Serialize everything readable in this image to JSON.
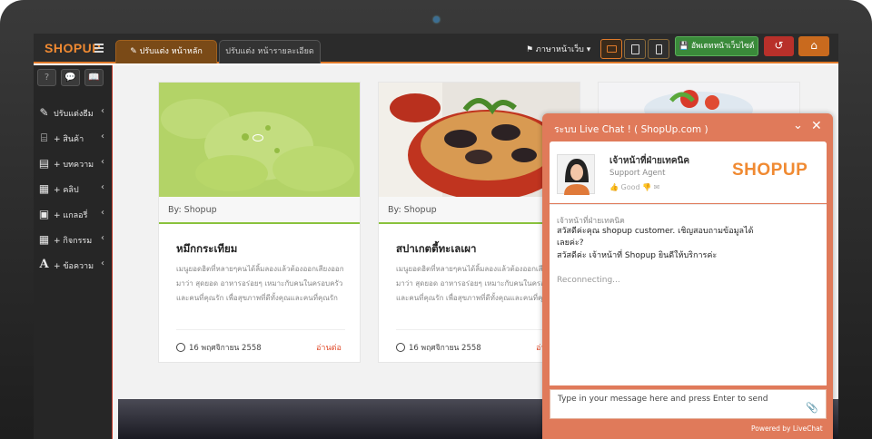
{
  "topbar": {
    "logo": "SHOPUP",
    "tabs": [
      {
        "label": "ปรับแต่ง หน้าหลัก",
        "active": true
      },
      {
        "label": "ปรับแต่ง หน้ารายละเอียด",
        "active": false
      }
    ],
    "language": "⚑ ภาษาหน้าเว็บ ▾",
    "update_label": "💾 อัพเดทหน้าเว็บไซต์",
    "undo_icon": "undo-icon",
    "home_icon": "home-icon",
    "accent_color": "#e07a2a"
  },
  "sidebar": {
    "tools": [
      "?",
      "💬",
      "📖"
    ],
    "items": [
      {
        "label": "ปรับแต่งธีม",
        "icon": "edit-icon",
        "glyph": "✎"
      },
      {
        "label": "+ สินค้า",
        "icon": "gift-icon",
        "glyph": "🎁"
      },
      {
        "label": "+ บทความ",
        "icon": "document-icon",
        "glyph": "▤"
      },
      {
        "label": "+ คลิป",
        "icon": "film-icon",
        "glyph": "▦"
      },
      {
        "label": "+ แกลอรี่",
        "icon": "image-icon",
        "glyph": "▣"
      },
      {
        "label": "+ กิจกรรม",
        "icon": "calendar-icon",
        "glyph": "▦"
      },
      {
        "label": "+ ข้อความ",
        "icon": "text-icon",
        "glyph": "A"
      }
    ]
  },
  "cards": [
    {
      "by": "By:  Shopup",
      "title": "หมึกกระเทียม",
      "desc": "เมนูยอดฮิตที่หลายๆคนได้ลิ้มลองแล้วต้องออกเสียงออกมาว่า สุดยอด อาหารอร่อยๆ เหมาะกับคนในครอบครัวและคนที่คุณรัก เพื่อสุขภาพที่ดีทั้งคุณและคนที่คุณรัก",
      "date": "16 พฤศจิกายน 2558",
      "more": "อ่านต่อ"
    },
    {
      "by": "By:  Shopup",
      "title": "สปาเกตตี้ทะเลเผา",
      "desc": "เมนูยอดฮิตที่หลายๆคนได้ลิ้มลองแล้วต้องออกเสียงออกมาว่า สุดยอด อาหารอร่อยๆ เหมาะกับคนในครอบครัวและคนที่คุณรัก เพื่อสุขภาพที่ดีทั้งคุณและคนที่คุณรัก",
      "date": "16 พฤศจิกายน 2558",
      "more": "อ่านต่อ"
    }
  ],
  "livechat": {
    "title": "ระบบ  Live Chat ! ( ShopUp.com )",
    "agent_name": "เจ้าหน้าที่ฝ่ายเทคนิค",
    "agent_role": "Support Agent",
    "rating_label": "Good",
    "logo": "SHOPUP",
    "messages": [
      {
        "sender": "เจ้าหน้าที่ฝ่ายเทคนิค",
        "text": "สวัสดีค่ะคุณ shopup customer. เชิญสอบถามข้อมูลได้เลยค่ะ?"
      },
      {
        "sender": "",
        "text": "สวัสดีค่ะ เจ้าหน้าที่ Shopup ยินดีให้บริการค่ะ"
      }
    ],
    "status": "Reconnecting...",
    "input_placeholder": "Type in your message here and press Enter to send",
    "powered_by": "Powered by LiveChat",
    "theme_color": "#e07a5a"
  }
}
